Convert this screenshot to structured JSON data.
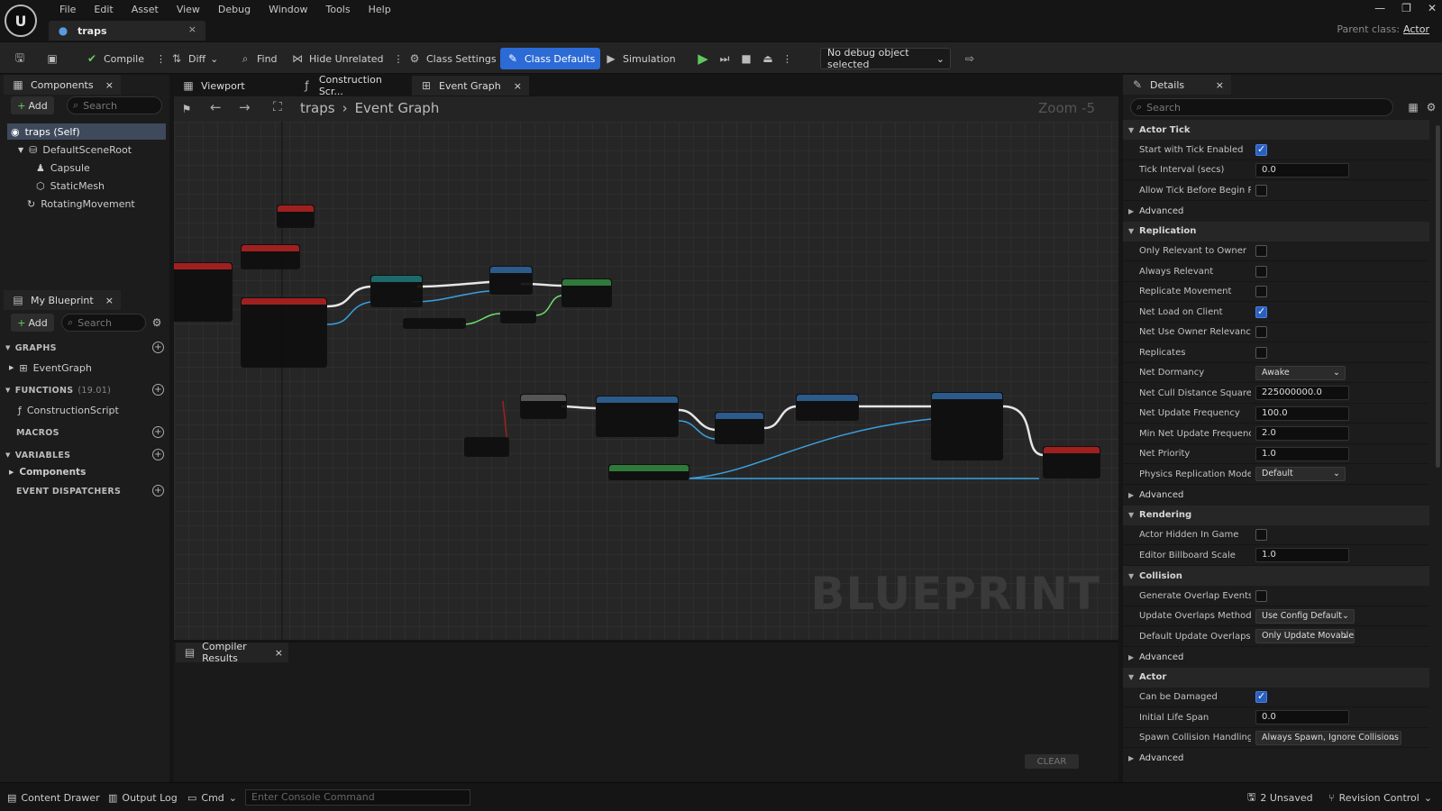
{
  "menu": [
    "File",
    "Edit",
    "Asset",
    "View",
    "Debug",
    "Window",
    "Tools",
    "Help"
  ],
  "document_tab": "traps",
  "parent_class": {
    "label": "Parent class:",
    "value": "Actor"
  },
  "toolbar": {
    "compile": "Compile",
    "diff": "Diff",
    "find": "Find",
    "hide_unrelated": "Hide Unrelated",
    "class_settings": "Class Settings",
    "class_defaults": "Class Defaults",
    "simulation": "Simulation",
    "debug_object": "No debug object selected"
  },
  "components": {
    "tab": "Components",
    "add": "Add",
    "search_placeholder": "Search",
    "items": [
      "traps (Self)",
      "DefaultSceneRoot",
      "Capsule",
      "StaticMesh",
      "RotatingMovement"
    ]
  },
  "my_blueprint": {
    "tab": "My Blueprint",
    "add": "Add",
    "search_placeholder": "Search",
    "graphs": "GRAPHS",
    "event_graph": "EventGraph",
    "functions": "FUNCTIONS",
    "functions_count": "(19.01)",
    "construction_script": "ConstructionScript",
    "macros": "MACROS",
    "variables": "VARIABLES",
    "components": "Components",
    "event_dispatchers": "EVENT DISPATCHERS"
  },
  "graph_tabs": [
    "Viewport",
    "Construction Scr...",
    "Event Graph"
  ],
  "breadcrumb": {
    "root": "traps",
    "current": "Event Graph"
  },
  "zoom": "Zoom -5",
  "watermark": "BLUEPRINT",
  "compiler": {
    "tab": "Compiler Results",
    "clear": "CLEAR"
  },
  "details": {
    "tab": "Details",
    "search_placeholder": "Search",
    "sections": [
      {
        "title": "Actor Tick",
        "rows": [
          {
            "label": "Start with Tick Enabled",
            "type": "check",
            "value": true
          },
          {
            "label": "Tick Interval (secs)",
            "type": "text",
            "value": "0.0"
          },
          {
            "label": "Allow Tick Before Begin P...",
            "type": "check",
            "value": false
          },
          {
            "label": "Advanced",
            "type": "adv"
          }
        ]
      },
      {
        "title": "Replication",
        "rows": [
          {
            "label": "Only Relevant to Owner",
            "type": "check",
            "value": false
          },
          {
            "label": "Always Relevant",
            "type": "check",
            "value": false
          },
          {
            "label": "Replicate Movement",
            "type": "check",
            "value": false
          },
          {
            "label": "Net Load on Client",
            "type": "check",
            "value": true
          },
          {
            "label": "Net Use Owner Relevancy",
            "type": "check",
            "value": false
          },
          {
            "label": "Replicates",
            "type": "check",
            "value": false
          },
          {
            "label": "Net Dormancy",
            "type": "dd",
            "value": "Awake"
          },
          {
            "label": "Net Cull Distance Squared",
            "type": "text",
            "value": "225000000.0"
          },
          {
            "label": "Net Update Frequency",
            "type": "text",
            "value": "100.0"
          },
          {
            "label": "Min Net Update Frequency",
            "type": "text",
            "value": "2.0"
          },
          {
            "label": "Net Priority",
            "type": "text",
            "value": "1.0"
          },
          {
            "label": "Physics Replication Mode",
            "type": "dd",
            "value": "Default"
          },
          {
            "label": "Advanced",
            "type": "adv"
          }
        ]
      },
      {
        "title": "Rendering",
        "rows": [
          {
            "label": "Actor Hidden In Game",
            "type": "check",
            "value": false
          },
          {
            "label": "Editor Billboard Scale",
            "type": "text",
            "value": "1.0"
          }
        ]
      },
      {
        "title": "Collision",
        "rows": [
          {
            "label": "Generate Overlap Events...",
            "type": "check",
            "value": false
          },
          {
            "label": "Update Overlaps Method...",
            "type": "dd",
            "value": "Use Config Default"
          },
          {
            "label": "Default Update Overlaps...",
            "type": "dd",
            "value": "Only Update Movable"
          },
          {
            "label": "Advanced",
            "type": "adv"
          }
        ]
      },
      {
        "title": "Actor",
        "rows": [
          {
            "label": "Can be Damaged",
            "type": "check",
            "value": true
          },
          {
            "label": "Initial Life Span",
            "type": "text",
            "value": "0.0"
          },
          {
            "label": "Spawn Collision Handling...",
            "type": "dd",
            "value": "Always Spawn, Ignore Collisions"
          },
          {
            "label": "Advanced",
            "type": "adv"
          }
        ]
      }
    ]
  },
  "statusbar": {
    "content_drawer": "Content Drawer",
    "output_log": "Output Log",
    "cmd": "Cmd",
    "console_placeholder": "Enter Console Command",
    "unsaved": "2 Unsaved",
    "revision": "Revision Control"
  },
  "colors": {
    "accent": "#2c6ad6",
    "event_node": "#a02020",
    "function_node": "#2c5a8a",
    "variable_node": "#2f7a3a"
  }
}
